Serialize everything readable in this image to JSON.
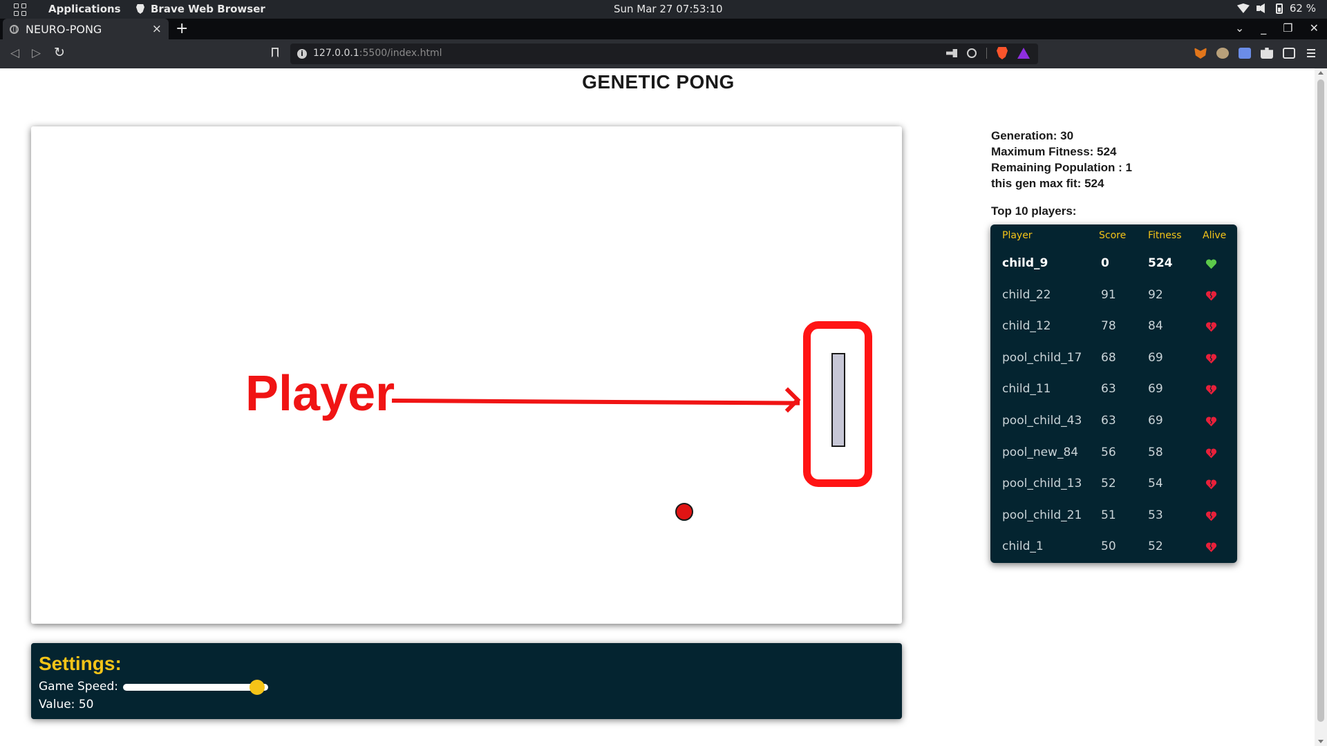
{
  "os": {
    "apps_label": "Applications",
    "active_app": "Brave Web Browser",
    "clock": "Sun Mar 27  07:53:10",
    "battery": "62 %"
  },
  "browser": {
    "tab_title": "NEURO-PONG",
    "tab_close": "×",
    "new_tab": "+",
    "url_host": "127.0.0.1",
    "url_rest": ":5500/index.html",
    "info_glyph": "i",
    "back_glyph": "◁",
    "forward_glyph": "▷",
    "reload_glyph": "↻",
    "win_dropdown": "⌄",
    "win_minimize": "_",
    "win_restore": "❐",
    "win_close": "✕"
  },
  "page": {
    "title": "GENETIC PONG"
  },
  "annotation": {
    "label": "Player",
    "color": "#f01414"
  },
  "game": {
    "ball_color": "#e01414",
    "paddle_color": "#c7c7d6"
  },
  "settings": {
    "heading": "Settings:",
    "speed_label": "Game Speed:",
    "value_line": "Value: 50",
    "speed_value": 50,
    "speed_max": 54,
    "accent": "#f5c418",
    "panel_bg": "#042430"
  },
  "stats": {
    "generation": "Generation: 30",
    "max_fitness": "Maximum Fitness: 524",
    "remaining": "Remaining Population : 1",
    "gen_max_fit": "this gen max fit: 524"
  },
  "leaderboard": {
    "label": "Top 10 players:",
    "headers": {
      "player": "Player",
      "score": "Score",
      "fitness": "Fitness",
      "alive": "Alive"
    },
    "rows": [
      {
        "player": "child_9",
        "score": "0",
        "fitness": "524",
        "alive": true
      },
      {
        "player": "child_22",
        "score": "91",
        "fitness": "92",
        "alive": false
      },
      {
        "player": "child_12",
        "score": "78",
        "fitness": "84",
        "alive": false
      },
      {
        "player": "pool_child_17",
        "score": "68",
        "fitness": "69",
        "alive": false
      },
      {
        "player": "child_11",
        "score": "63",
        "fitness": "69",
        "alive": false
      },
      {
        "player": "pool_child_43",
        "score": "63",
        "fitness": "69",
        "alive": false
      },
      {
        "player": "pool_new_84",
        "score": "56",
        "fitness": "58",
        "alive": false
      },
      {
        "player": "pool_child_13",
        "score": "52",
        "fitness": "54",
        "alive": false
      },
      {
        "player": "pool_child_21",
        "score": "51",
        "fitness": "53",
        "alive": false
      },
      {
        "player": "child_1",
        "score": "50",
        "fitness": "52",
        "alive": false
      }
    ],
    "alive_color": "#5cc94a",
    "dead_color": "#e8203a"
  }
}
